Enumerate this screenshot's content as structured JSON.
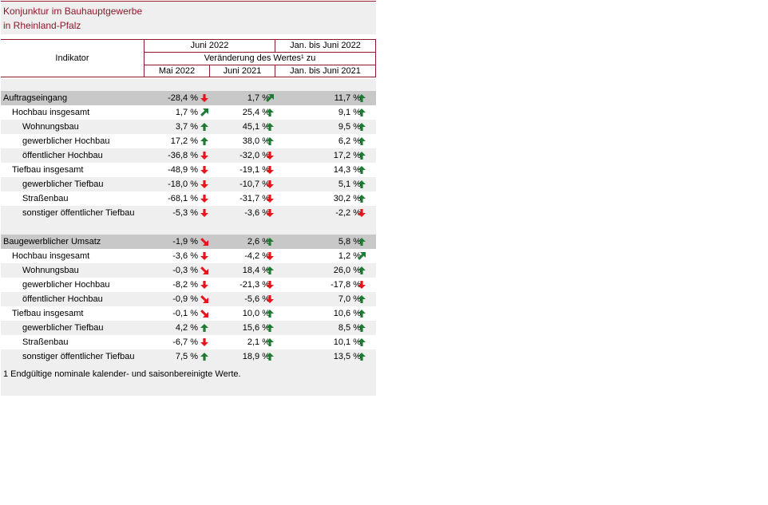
{
  "title": {
    "line1": "Konjunktur im Bauhauptgewerbe",
    "line2": "in Rheinland-Pfalz"
  },
  "header": {
    "indicator": "Indikator",
    "period_month": "Juni 2022",
    "period_cumulative": "Jan. bis Juni 2022",
    "change_label": "Veränderung des Wertes¹ zu",
    "col1": "Mai 2022",
    "col2": "Juni 2021",
    "col3": "Jan. bis Juni 2021"
  },
  "colors": {
    "up": "#1e7b34",
    "down": "#e8141c",
    "title": "#8b1a2b"
  },
  "sections": [
    {
      "rows": [
        {
          "label": "Auftragseingang",
          "indent": 0,
          "group": true,
          "v": [
            "-28,4 %",
            "1,7 %",
            "11,7 %"
          ],
          "a": [
            "down",
            "up-right",
            "up"
          ]
        },
        {
          "label": "Hochbau insgesamt",
          "indent": 1,
          "v": [
            "1,7 %",
            "25,4 %",
            "9,1 %"
          ],
          "a": [
            "up-right",
            "up",
            "up"
          ]
        },
        {
          "label": "Wohnungsbau",
          "indent": 2,
          "v": [
            "3,7 %",
            "45,1 %",
            "9,5 %"
          ],
          "a": [
            "up",
            "up",
            "up"
          ]
        },
        {
          "label": "gewerblicher Hochbau",
          "indent": 2,
          "v": [
            "17,2 %",
            "38,0 %",
            "6,2 %"
          ],
          "a": [
            "up",
            "up",
            "up"
          ]
        },
        {
          "label": "öffentlicher Hochbau",
          "indent": 2,
          "v": [
            "-36,8 %",
            "-32,0 %",
            "17,2 %"
          ],
          "a": [
            "down",
            "down",
            "up"
          ]
        },
        {
          "label": "Tiefbau insgesamt",
          "indent": 1,
          "v": [
            "-48,9 %",
            "-19,1 %",
            "14,3 %"
          ],
          "a": [
            "down",
            "down",
            "up"
          ]
        },
        {
          "label": "gewerblicher Tiefbau",
          "indent": 2,
          "v": [
            "-18,0 %",
            "-10,7 %",
            "5,1 %"
          ],
          "a": [
            "down",
            "down",
            "up"
          ]
        },
        {
          "label": "Straßenbau",
          "indent": 2,
          "v": [
            "-68,1 %",
            "-31,7 %",
            "30,2 %"
          ],
          "a": [
            "down",
            "down",
            "up"
          ]
        },
        {
          "label": "sonstiger öffentlicher Tiefbau",
          "indent": 2,
          "v": [
            "-5,3 %",
            "-3,6 %",
            "-2,2 %"
          ],
          "a": [
            "down",
            "down",
            "down"
          ]
        }
      ]
    },
    {
      "rows": [
        {
          "label": "Baugewerblicher Umsatz",
          "indent": 0,
          "group": true,
          "v": [
            "-1,9 %",
            "2,6 %",
            "5,8 %"
          ],
          "a": [
            "down-right",
            "up",
            "up"
          ]
        },
        {
          "label": "Hochbau insgesamt",
          "indent": 1,
          "v": [
            "-3,6 %",
            "-4,2 %",
            "1,2 %"
          ],
          "a": [
            "down",
            "down",
            "up-right"
          ]
        },
        {
          "label": "Wohnungsbau",
          "indent": 2,
          "v": [
            "-0,3 %",
            "18,4 %",
            "26,0 %"
          ],
          "a": [
            "down-right",
            "up",
            "up"
          ]
        },
        {
          "label": "gewerblicher Hochbau",
          "indent": 2,
          "v": [
            "-8,2 %",
            "-21,3 %",
            "-17,8 %"
          ],
          "a": [
            "down",
            "down",
            "down"
          ]
        },
        {
          "label": "öffentlicher Hochbau",
          "indent": 2,
          "v": [
            "-0,9 %",
            "-5,6 %",
            "7,0 %"
          ],
          "a": [
            "down-right",
            "down",
            "up"
          ]
        },
        {
          "label": "Tiefbau insgesamt",
          "indent": 1,
          "v": [
            "-0,1 %",
            "10,0 %",
            "10,6 %"
          ],
          "a": [
            "down-right",
            "up",
            "up"
          ]
        },
        {
          "label": "gewerblicher Tiefbau",
          "indent": 2,
          "v": [
            "4,2 %",
            "15,6 %",
            "8,5 %"
          ],
          "a": [
            "up",
            "up",
            "up"
          ]
        },
        {
          "label": "Straßenbau",
          "indent": 2,
          "v": [
            "-6,7 %",
            "2,1 %",
            "10,1 %"
          ],
          "a": [
            "down",
            "up",
            "up"
          ]
        },
        {
          "label": "sonstiger öffentlicher Tiefbau",
          "indent": 2,
          "v": [
            "7,5 %",
            "18,9 %",
            "13,5 %"
          ],
          "a": [
            "up",
            "up",
            "up"
          ]
        }
      ]
    }
  ],
  "footnote": "1 Endgültige nominale kalender- und saisonbereinigte Werte."
}
